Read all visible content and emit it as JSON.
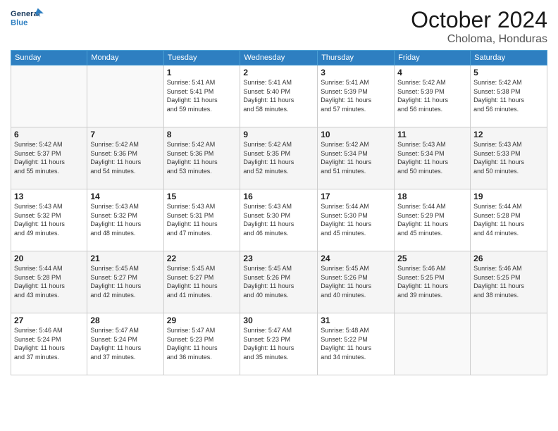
{
  "header": {
    "logo_line1": "General",
    "logo_line2": "Blue",
    "month": "October 2024",
    "location": "Choloma, Honduras"
  },
  "weekdays": [
    "Sunday",
    "Monday",
    "Tuesday",
    "Wednesday",
    "Thursday",
    "Friday",
    "Saturday"
  ],
  "weeks": [
    [
      {
        "day": "",
        "info": ""
      },
      {
        "day": "",
        "info": ""
      },
      {
        "day": "1",
        "info": "Sunrise: 5:41 AM\nSunset: 5:41 PM\nDaylight: 11 hours\nand 59 minutes."
      },
      {
        "day": "2",
        "info": "Sunrise: 5:41 AM\nSunset: 5:40 PM\nDaylight: 11 hours\nand 58 minutes."
      },
      {
        "day": "3",
        "info": "Sunrise: 5:41 AM\nSunset: 5:39 PM\nDaylight: 11 hours\nand 57 minutes."
      },
      {
        "day": "4",
        "info": "Sunrise: 5:42 AM\nSunset: 5:39 PM\nDaylight: 11 hours\nand 56 minutes."
      },
      {
        "day": "5",
        "info": "Sunrise: 5:42 AM\nSunset: 5:38 PM\nDaylight: 11 hours\nand 56 minutes."
      }
    ],
    [
      {
        "day": "6",
        "info": "Sunrise: 5:42 AM\nSunset: 5:37 PM\nDaylight: 11 hours\nand 55 minutes."
      },
      {
        "day": "7",
        "info": "Sunrise: 5:42 AM\nSunset: 5:36 PM\nDaylight: 11 hours\nand 54 minutes."
      },
      {
        "day": "8",
        "info": "Sunrise: 5:42 AM\nSunset: 5:36 PM\nDaylight: 11 hours\nand 53 minutes."
      },
      {
        "day": "9",
        "info": "Sunrise: 5:42 AM\nSunset: 5:35 PM\nDaylight: 11 hours\nand 52 minutes."
      },
      {
        "day": "10",
        "info": "Sunrise: 5:42 AM\nSunset: 5:34 PM\nDaylight: 11 hours\nand 51 minutes."
      },
      {
        "day": "11",
        "info": "Sunrise: 5:43 AM\nSunset: 5:34 PM\nDaylight: 11 hours\nand 50 minutes."
      },
      {
        "day": "12",
        "info": "Sunrise: 5:43 AM\nSunset: 5:33 PM\nDaylight: 11 hours\nand 50 minutes."
      }
    ],
    [
      {
        "day": "13",
        "info": "Sunrise: 5:43 AM\nSunset: 5:32 PM\nDaylight: 11 hours\nand 49 minutes."
      },
      {
        "day": "14",
        "info": "Sunrise: 5:43 AM\nSunset: 5:32 PM\nDaylight: 11 hours\nand 48 minutes."
      },
      {
        "day": "15",
        "info": "Sunrise: 5:43 AM\nSunset: 5:31 PM\nDaylight: 11 hours\nand 47 minutes."
      },
      {
        "day": "16",
        "info": "Sunrise: 5:43 AM\nSunset: 5:30 PM\nDaylight: 11 hours\nand 46 minutes."
      },
      {
        "day": "17",
        "info": "Sunrise: 5:44 AM\nSunset: 5:30 PM\nDaylight: 11 hours\nand 45 minutes."
      },
      {
        "day": "18",
        "info": "Sunrise: 5:44 AM\nSunset: 5:29 PM\nDaylight: 11 hours\nand 45 minutes."
      },
      {
        "day": "19",
        "info": "Sunrise: 5:44 AM\nSunset: 5:28 PM\nDaylight: 11 hours\nand 44 minutes."
      }
    ],
    [
      {
        "day": "20",
        "info": "Sunrise: 5:44 AM\nSunset: 5:28 PM\nDaylight: 11 hours\nand 43 minutes."
      },
      {
        "day": "21",
        "info": "Sunrise: 5:45 AM\nSunset: 5:27 PM\nDaylight: 11 hours\nand 42 minutes."
      },
      {
        "day": "22",
        "info": "Sunrise: 5:45 AM\nSunset: 5:27 PM\nDaylight: 11 hours\nand 41 minutes."
      },
      {
        "day": "23",
        "info": "Sunrise: 5:45 AM\nSunset: 5:26 PM\nDaylight: 11 hours\nand 40 minutes."
      },
      {
        "day": "24",
        "info": "Sunrise: 5:45 AM\nSunset: 5:26 PM\nDaylight: 11 hours\nand 40 minutes."
      },
      {
        "day": "25",
        "info": "Sunrise: 5:46 AM\nSunset: 5:25 PM\nDaylight: 11 hours\nand 39 minutes."
      },
      {
        "day": "26",
        "info": "Sunrise: 5:46 AM\nSunset: 5:25 PM\nDaylight: 11 hours\nand 38 minutes."
      }
    ],
    [
      {
        "day": "27",
        "info": "Sunrise: 5:46 AM\nSunset: 5:24 PM\nDaylight: 11 hours\nand 37 minutes."
      },
      {
        "day": "28",
        "info": "Sunrise: 5:47 AM\nSunset: 5:24 PM\nDaylight: 11 hours\nand 37 minutes."
      },
      {
        "day": "29",
        "info": "Sunrise: 5:47 AM\nSunset: 5:23 PM\nDaylight: 11 hours\nand 36 minutes."
      },
      {
        "day": "30",
        "info": "Sunrise: 5:47 AM\nSunset: 5:23 PM\nDaylight: 11 hours\nand 35 minutes."
      },
      {
        "day": "31",
        "info": "Sunrise: 5:48 AM\nSunset: 5:22 PM\nDaylight: 11 hours\nand 34 minutes."
      },
      {
        "day": "",
        "info": ""
      },
      {
        "day": "",
        "info": ""
      }
    ]
  ]
}
